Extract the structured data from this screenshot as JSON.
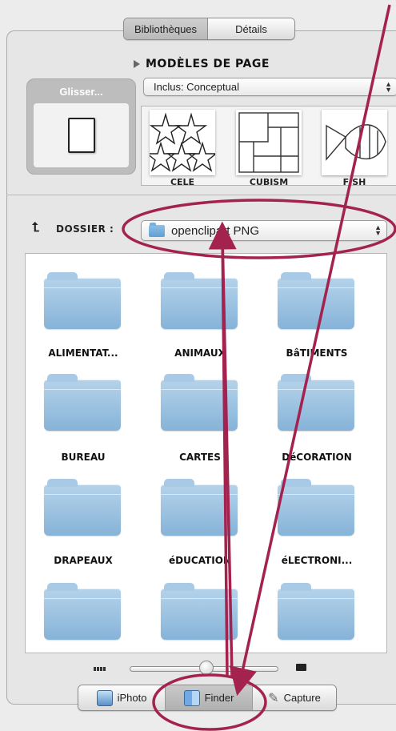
{
  "tabs": {
    "libraries": "Bibliothèques",
    "details": "Détails"
  },
  "page_templates": {
    "header": "MODÈLES DE PAGE",
    "select_value": "Inclus: Conceptual",
    "drag_label": "Glisser...",
    "thumbnails": [
      "CELE",
      "CUBISM",
      "FISH"
    ]
  },
  "folders": {
    "label": "DOSSIER :",
    "select_value": "openclipart PNG",
    "items": [
      "ALIMENTAT...",
      "ANIMAUX",
      "BâTIMENTS",
      "BUREAU",
      "CARTES",
      "DéCORATION",
      "DRAPEAUX",
      "éDUCATION",
      "éLECTRONI...",
      "",
      "",
      ""
    ]
  },
  "source_tabs": [
    "iPhoto",
    "Finder",
    "Capture"
  ],
  "annotation_color": "#a3234e",
  "icons": {
    "up": "up-arrow-icon",
    "folder": "folder-icon",
    "iphoto": "iphoto-icon",
    "finder": "finder-icon",
    "capture": "pen-icon"
  }
}
